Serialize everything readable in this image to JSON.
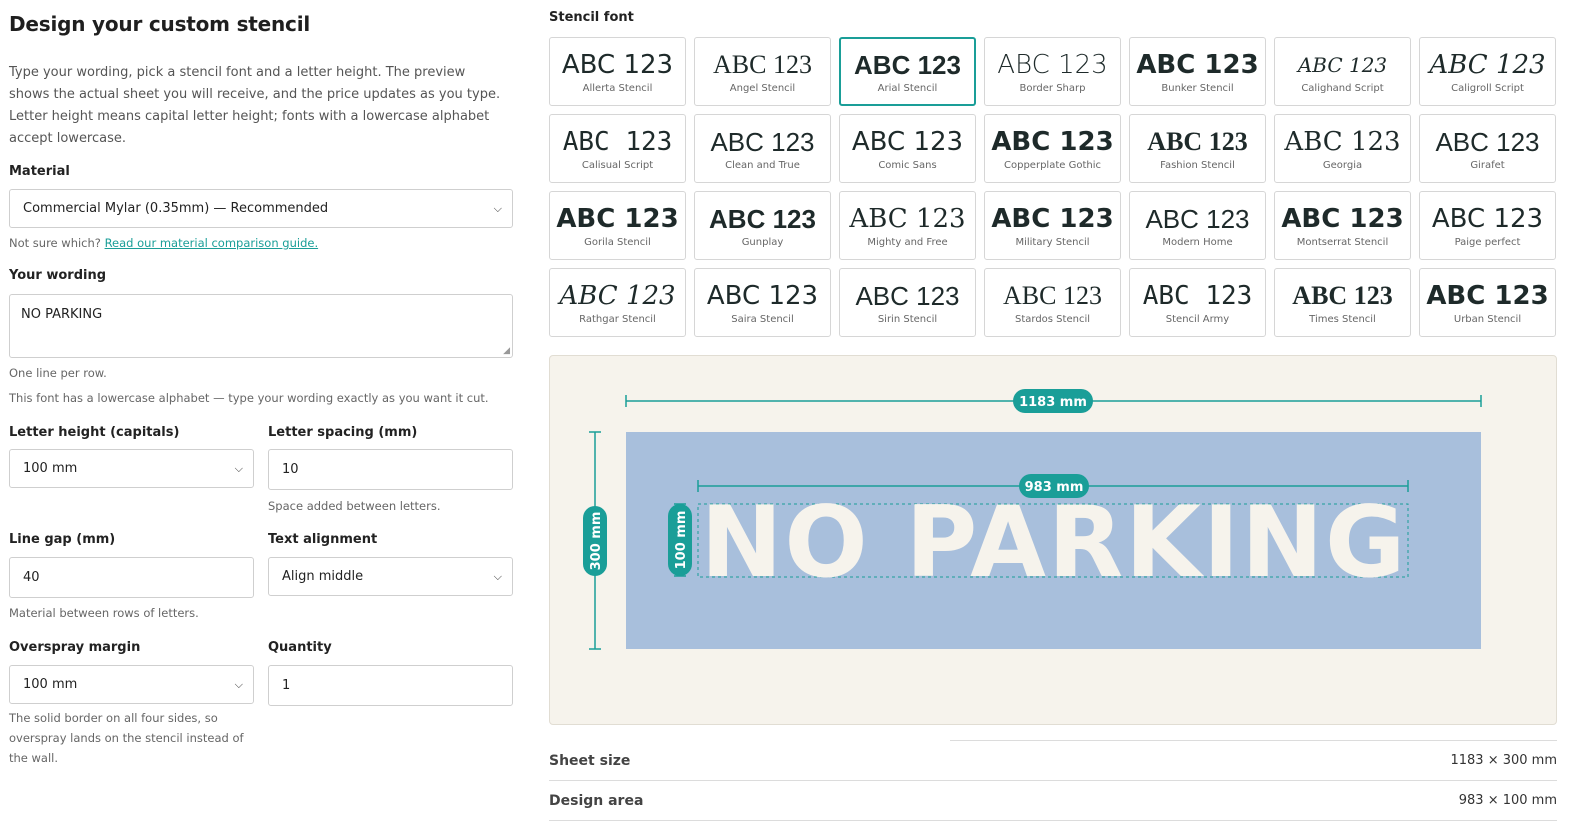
{
  "page": {
    "title": "Design your custom stencil",
    "intro": "Type your wording, pick a stencil font and a letter height. The preview shows the actual sheet you will receive, and the price updates as you type. Letter height means capital letter height; fonts with a lowercase alphabet accept lowercase."
  },
  "material": {
    "label": "Material",
    "value": "Commercial Mylar (0.35mm) — Recommended",
    "help_prefix": "Not sure which? ",
    "help_link": "Read our material comparison guide."
  },
  "wording": {
    "label": "Your wording",
    "value": "NO PARKING",
    "help1": "One line per row.",
    "help2": "This font has a lowercase alphabet — type your wording exactly as you want it cut."
  },
  "letter_height": {
    "label": "Letter height (capitals)",
    "value": "100 mm"
  },
  "letter_spacing": {
    "label": "Letter spacing (mm)",
    "value": "10",
    "help": "Space added between letters."
  },
  "line_gap": {
    "label": "Line gap (mm)",
    "value": "40",
    "help": "Material between rows of letters."
  },
  "text_alignment": {
    "label": "Text alignment",
    "value": "Align middle"
  },
  "overspray": {
    "label": "Overspray margin",
    "value": "100 mm",
    "help": "The solid border on all four sides, so overspray lands on the stencil instead of the wall."
  },
  "quantity": {
    "label": "Quantity",
    "value": "1"
  },
  "fonts": {
    "label": "Stencil font",
    "sample": "ABC 123",
    "selected_index": 2,
    "items": [
      "Allerta Stencil",
      "Angel Stencil",
      "Arial Stencil",
      "Border Sharp",
      "Bunker Stencil",
      "Calighand Script",
      "Caligroll Script",
      "Calisual Script",
      "Clean and True",
      "Comic Sans",
      "Copperplate Gothic",
      "Fashion Stencil",
      "Georgia",
      "Girafet",
      "Gorila Stencil",
      "Gunplay",
      "Mighty and Free",
      "Military Stencil",
      "Modern Home",
      "Montserrat Stencil",
      "Paige perfect",
      "Rathgar Stencil",
      "Saira Stencil",
      "Sirin Stencil",
      "Stardos Stencil",
      "Stencil Army",
      "Times Stencil",
      "Urban Stencil"
    ]
  },
  "preview": {
    "text": "NO PARKING",
    "sheet_width_label": "1183 mm",
    "sheet_height_label": "300 mm",
    "design_width_label": "983 mm",
    "letter_height_label": "100 mm",
    "sheet_color": "#a8bfdc",
    "letter_color": "#f6f3ec",
    "accent_color": "#1a9e98"
  },
  "specs": [
    {
      "label": "Sheet size",
      "value": "1183 × 300 mm"
    },
    {
      "label": "Design area",
      "value": "983 × 100 mm"
    }
  ]
}
